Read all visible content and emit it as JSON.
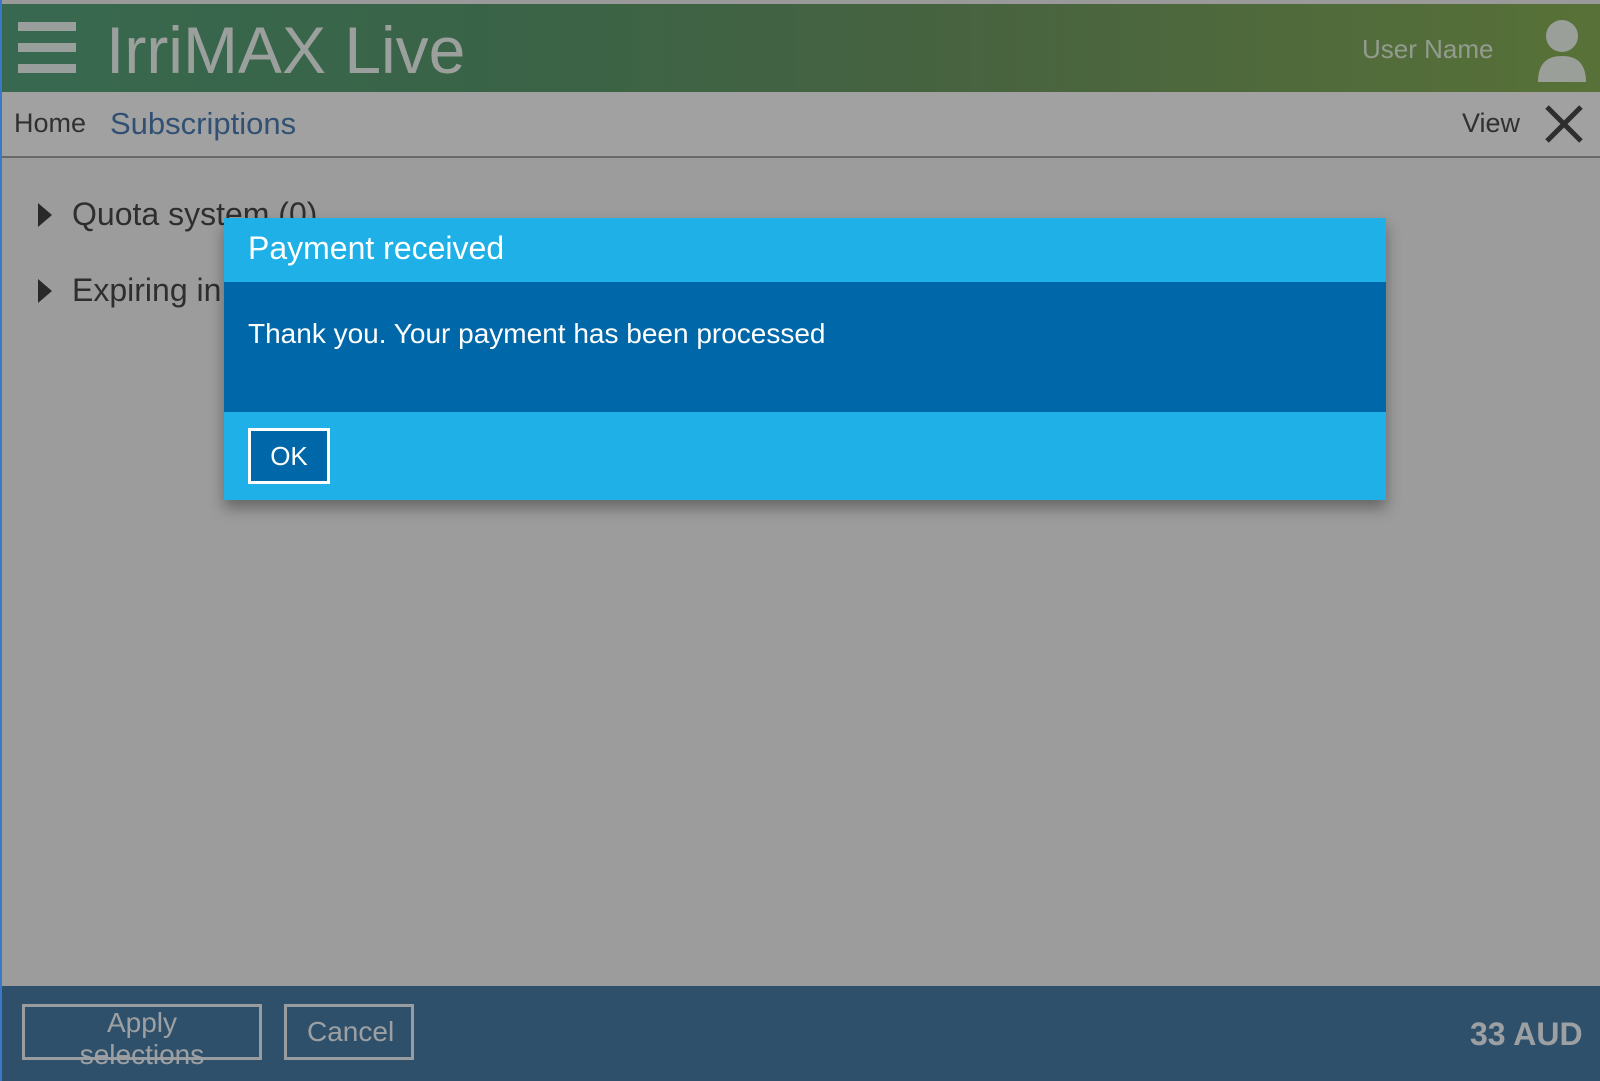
{
  "header": {
    "app_title": "IrriMAX Live",
    "user_name": "User Name",
    "menu_icon": "hamburger-menu-icon",
    "user_icon": "user-avatar-icon"
  },
  "nav": {
    "home": "Home",
    "current": "Subscriptions",
    "view": "View",
    "close_icon": "close-icon"
  },
  "content": {
    "items": [
      {
        "label": "Quota system (0)",
        "expanded": false
      },
      {
        "label": "Expiring in",
        "expanded": false
      }
    ]
  },
  "footer": {
    "apply_label": "Apply selections",
    "cancel_label": "Cancel",
    "total": "33 AUD"
  },
  "dialog": {
    "title": "Payment received",
    "message": "Thank you. Your payment has been processed",
    "ok_label": "OK"
  },
  "colors": {
    "dialog_header": "#1eb0e6",
    "dialog_body": "#0067a8",
    "footer": "#1b5a8e",
    "link": "#1f5a9e"
  }
}
